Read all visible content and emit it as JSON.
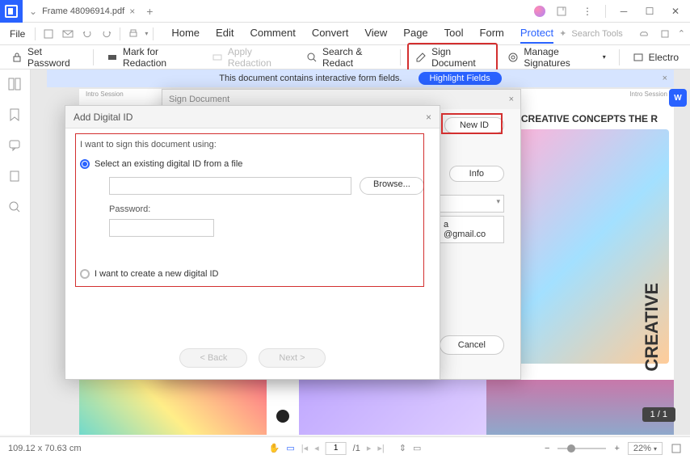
{
  "titlebar": {
    "filename": "Frame 48096914.pdf"
  },
  "menubar": {
    "file": "File",
    "tabs": [
      "Home",
      "Edit",
      "Comment",
      "Convert",
      "View",
      "Page",
      "Tool",
      "Form",
      "Protect"
    ],
    "search_placeholder": "Search Tools"
  },
  "ribbon": {
    "set_password": "Set Password",
    "mark_redaction": "Mark for Redaction",
    "apply_redaction": "Apply Redaction",
    "search_redact": "Search & Redact",
    "sign_document": "Sign Document",
    "manage_signatures": "Manage Signatures",
    "electronic": "Electro"
  },
  "banner": {
    "text": "This document contains interactive form fields.",
    "highlight": "Highlight Fields"
  },
  "doc": {
    "session_left": "Intro Session",
    "session_right": "Intro Session",
    "title": "E TO CREATIVE CONCEPTS THE R",
    "cepts": "CEPTS",
    "creative": "CREATIVE",
    "email_a": "a",
    "email": "@gmail.co"
  },
  "sign_dialog": {
    "title": "Sign Document",
    "new_id": "New ID",
    "info": "Info",
    "cancel": "Cancel"
  },
  "digid": {
    "title": "Add Digital ID",
    "prompt": "I want to sign this document using:",
    "opt_existing": "Select an existing digital ID from a file",
    "browse": "Browse...",
    "password": "Password:",
    "opt_create": "I want to create a new digital ID",
    "back": "< Back",
    "next": "Next >"
  },
  "statusbar": {
    "coords": "109.12 x 70.63 cm",
    "page_current": "1",
    "page_total": "/1",
    "zoom": "22%"
  },
  "page_badge": "1 / 1"
}
